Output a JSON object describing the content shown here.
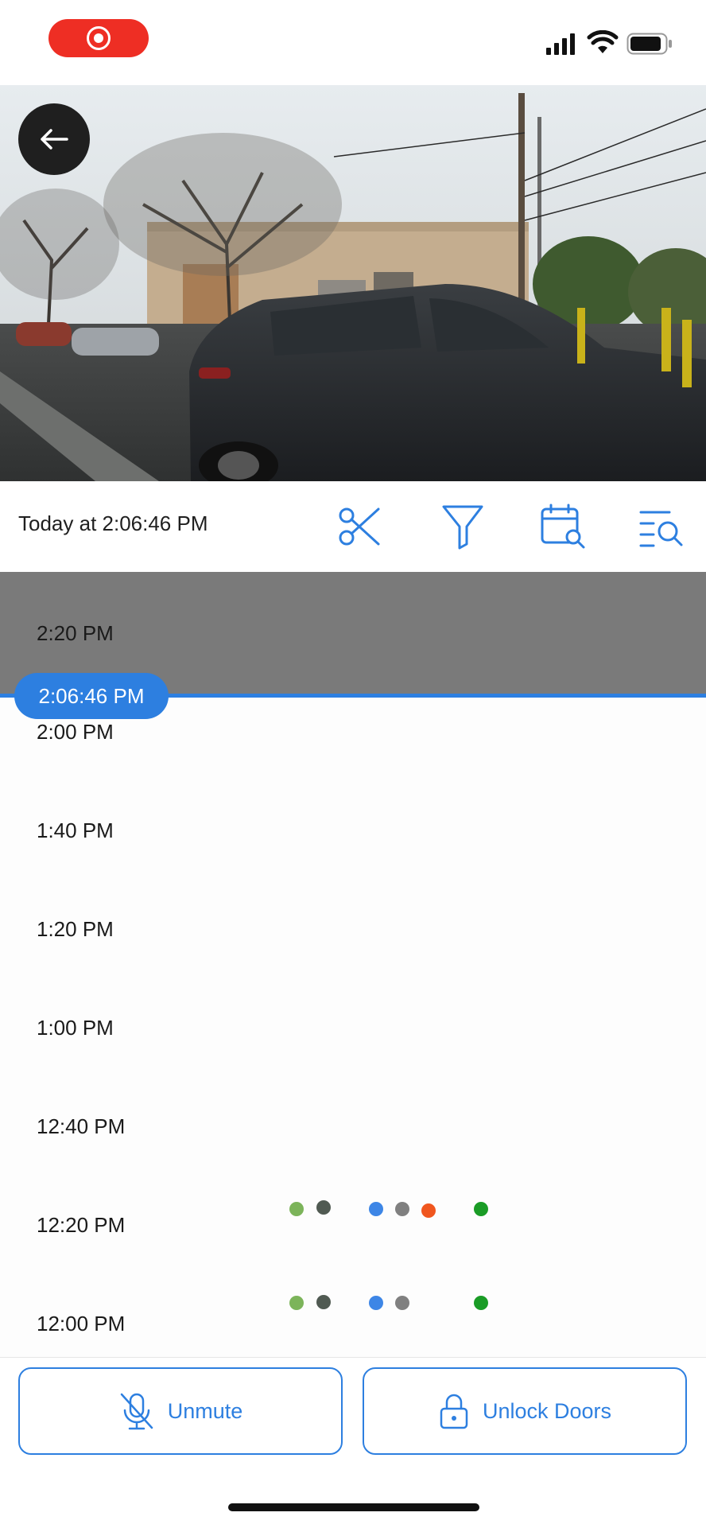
{
  "status_bar": {
    "record_icon": "screen-record-icon",
    "signal_icon": "cellular-signal-icon",
    "wifi_icon": "wifi-icon",
    "battery_icon": "battery-icon",
    "record_color": "#ee2e24"
  },
  "camera": {
    "back_icon": "arrow-left-icon"
  },
  "toolbar": {
    "timestamp": "Today at 2:06:46 PM",
    "icons": [
      "scissors-icon",
      "filter-icon",
      "calendar-search-icon",
      "list-search-icon"
    ],
    "accent": "#2d7fe0"
  },
  "timeline": {
    "current_time": "2:06:46 PM",
    "labels": [
      "2:20 PM",
      "2:00 PM",
      "1:40 PM",
      "1:20 PM",
      "1:00 PM",
      "12:40 PM",
      "12:20 PM",
      "12:00 PM"
    ],
    "event_colors": {
      "green_light": "#7cb45a",
      "dark_gray": "#505a52",
      "blue": "#3d86e6",
      "gray": "#808080",
      "orange": "#f0561e",
      "green": "#1a9c26"
    }
  },
  "actions": {
    "unmute_label": "Unmute",
    "unmute_icon": "microphone-off-icon",
    "unlock_label": "Unlock Doors",
    "unlock_icon": "lock-icon"
  }
}
